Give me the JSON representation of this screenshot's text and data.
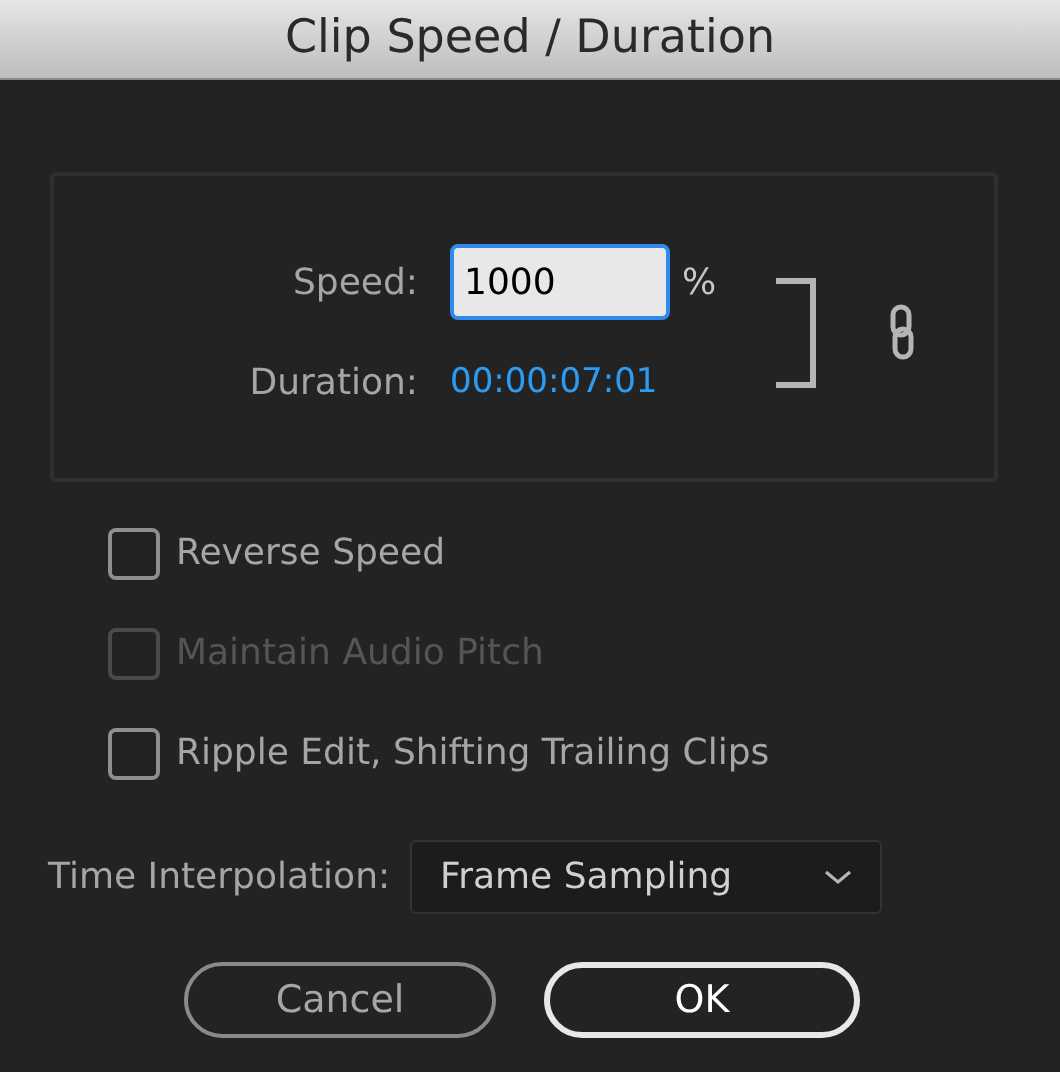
{
  "window": {
    "title": "Clip Speed / Duration"
  },
  "speed": {
    "label": "Speed:",
    "value": "1000",
    "unit": "%"
  },
  "duration": {
    "label": "Duration:",
    "value": "00:00:07:01"
  },
  "options": [
    {
      "label": "Reverse Speed",
      "checked": false,
      "disabled": false
    },
    {
      "label": "Maintain Audio Pitch",
      "checked": false,
      "disabled": true
    },
    {
      "label": "Ripple Edit, Shifting Trailing Clips",
      "checked": false,
      "disabled": false
    }
  ],
  "time_interpolation": {
    "label": "Time Interpolation:",
    "value": "Frame Sampling"
  },
  "buttons": [
    {
      "label": "Cancel",
      "primary": false
    },
    {
      "label": "OK",
      "primary": true
    }
  ]
}
